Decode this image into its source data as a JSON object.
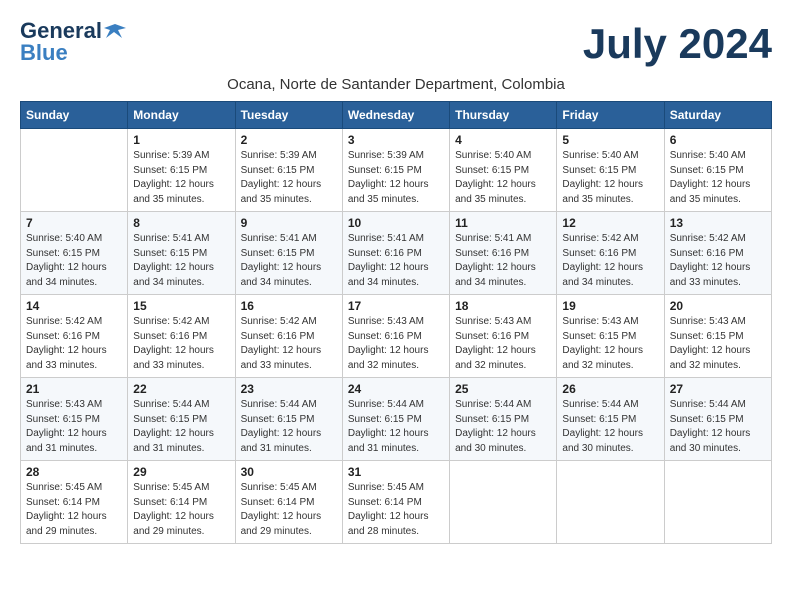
{
  "logo": {
    "general": "General",
    "blue": "Blue"
  },
  "title": "July 2024",
  "subtitle": "Ocana, Norte de Santander Department, Colombia",
  "days_of_week": [
    "Sunday",
    "Monday",
    "Tuesday",
    "Wednesday",
    "Thursday",
    "Friday",
    "Saturday"
  ],
  "weeks": [
    [
      {
        "num": "",
        "info": ""
      },
      {
        "num": "1",
        "info": "Sunrise: 5:39 AM\nSunset: 6:15 PM\nDaylight: 12 hours\nand 35 minutes."
      },
      {
        "num": "2",
        "info": "Sunrise: 5:39 AM\nSunset: 6:15 PM\nDaylight: 12 hours\nand 35 minutes."
      },
      {
        "num": "3",
        "info": "Sunrise: 5:39 AM\nSunset: 6:15 PM\nDaylight: 12 hours\nand 35 minutes."
      },
      {
        "num": "4",
        "info": "Sunrise: 5:40 AM\nSunset: 6:15 PM\nDaylight: 12 hours\nand 35 minutes."
      },
      {
        "num": "5",
        "info": "Sunrise: 5:40 AM\nSunset: 6:15 PM\nDaylight: 12 hours\nand 35 minutes."
      },
      {
        "num": "6",
        "info": "Sunrise: 5:40 AM\nSunset: 6:15 PM\nDaylight: 12 hours\nand 35 minutes."
      }
    ],
    [
      {
        "num": "7",
        "info": "Sunrise: 5:40 AM\nSunset: 6:15 PM\nDaylight: 12 hours\nand 34 minutes."
      },
      {
        "num": "8",
        "info": "Sunrise: 5:41 AM\nSunset: 6:15 PM\nDaylight: 12 hours\nand 34 minutes."
      },
      {
        "num": "9",
        "info": "Sunrise: 5:41 AM\nSunset: 6:15 PM\nDaylight: 12 hours\nand 34 minutes."
      },
      {
        "num": "10",
        "info": "Sunrise: 5:41 AM\nSunset: 6:16 PM\nDaylight: 12 hours\nand 34 minutes."
      },
      {
        "num": "11",
        "info": "Sunrise: 5:41 AM\nSunset: 6:16 PM\nDaylight: 12 hours\nand 34 minutes."
      },
      {
        "num": "12",
        "info": "Sunrise: 5:42 AM\nSunset: 6:16 PM\nDaylight: 12 hours\nand 34 minutes."
      },
      {
        "num": "13",
        "info": "Sunrise: 5:42 AM\nSunset: 6:16 PM\nDaylight: 12 hours\nand 33 minutes."
      }
    ],
    [
      {
        "num": "14",
        "info": "Sunrise: 5:42 AM\nSunset: 6:16 PM\nDaylight: 12 hours\nand 33 minutes."
      },
      {
        "num": "15",
        "info": "Sunrise: 5:42 AM\nSunset: 6:16 PM\nDaylight: 12 hours\nand 33 minutes."
      },
      {
        "num": "16",
        "info": "Sunrise: 5:42 AM\nSunset: 6:16 PM\nDaylight: 12 hours\nand 33 minutes."
      },
      {
        "num": "17",
        "info": "Sunrise: 5:43 AM\nSunset: 6:16 PM\nDaylight: 12 hours\nand 32 minutes."
      },
      {
        "num": "18",
        "info": "Sunrise: 5:43 AM\nSunset: 6:16 PM\nDaylight: 12 hours\nand 32 minutes."
      },
      {
        "num": "19",
        "info": "Sunrise: 5:43 AM\nSunset: 6:15 PM\nDaylight: 12 hours\nand 32 minutes."
      },
      {
        "num": "20",
        "info": "Sunrise: 5:43 AM\nSunset: 6:15 PM\nDaylight: 12 hours\nand 32 minutes."
      }
    ],
    [
      {
        "num": "21",
        "info": "Sunrise: 5:43 AM\nSunset: 6:15 PM\nDaylight: 12 hours\nand 31 minutes."
      },
      {
        "num": "22",
        "info": "Sunrise: 5:44 AM\nSunset: 6:15 PM\nDaylight: 12 hours\nand 31 minutes."
      },
      {
        "num": "23",
        "info": "Sunrise: 5:44 AM\nSunset: 6:15 PM\nDaylight: 12 hours\nand 31 minutes."
      },
      {
        "num": "24",
        "info": "Sunrise: 5:44 AM\nSunset: 6:15 PM\nDaylight: 12 hours\nand 31 minutes."
      },
      {
        "num": "25",
        "info": "Sunrise: 5:44 AM\nSunset: 6:15 PM\nDaylight: 12 hours\nand 30 minutes."
      },
      {
        "num": "26",
        "info": "Sunrise: 5:44 AM\nSunset: 6:15 PM\nDaylight: 12 hours\nand 30 minutes."
      },
      {
        "num": "27",
        "info": "Sunrise: 5:44 AM\nSunset: 6:15 PM\nDaylight: 12 hours\nand 30 minutes."
      }
    ],
    [
      {
        "num": "28",
        "info": "Sunrise: 5:45 AM\nSunset: 6:14 PM\nDaylight: 12 hours\nand 29 minutes."
      },
      {
        "num": "29",
        "info": "Sunrise: 5:45 AM\nSunset: 6:14 PM\nDaylight: 12 hours\nand 29 minutes."
      },
      {
        "num": "30",
        "info": "Sunrise: 5:45 AM\nSunset: 6:14 PM\nDaylight: 12 hours\nand 29 minutes."
      },
      {
        "num": "31",
        "info": "Sunrise: 5:45 AM\nSunset: 6:14 PM\nDaylight: 12 hours\nand 28 minutes."
      },
      {
        "num": "",
        "info": ""
      },
      {
        "num": "",
        "info": ""
      },
      {
        "num": "",
        "info": ""
      }
    ]
  ]
}
